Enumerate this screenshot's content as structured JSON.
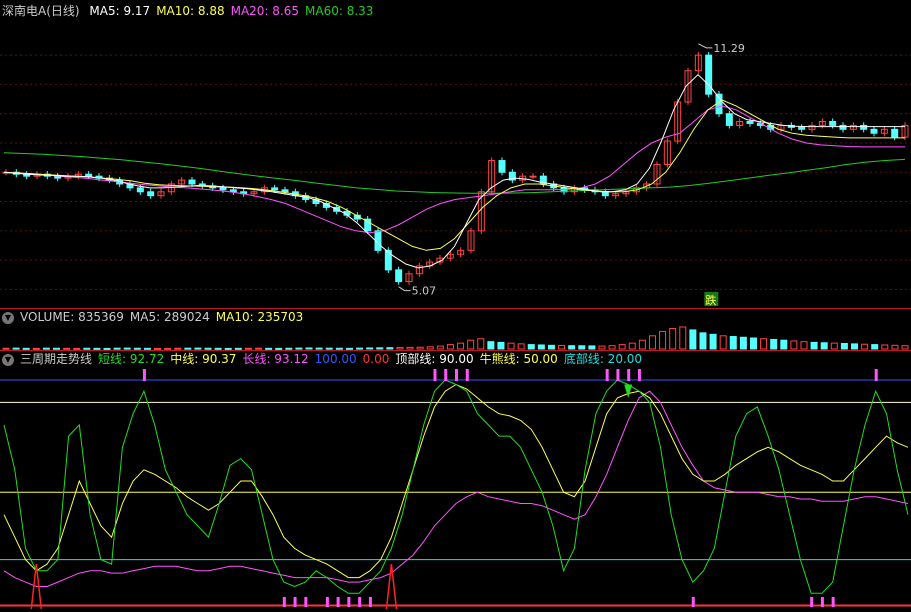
{
  "main": {
    "title": "深南电A(日线)",
    "ma_labels": [
      {
        "text": "MA5: 9.17",
        "color": "#ffffff"
      },
      {
        "text": "MA10: 8.88",
        "color": "#ffff54"
      },
      {
        "text": "MA20: 8.65",
        "color": "#ff54ff"
      },
      {
        "text": "MA60: 8.33",
        "color": "#22cc22"
      }
    ],
    "high_label": "11.29",
    "low_label": "5.07",
    "signal_label": "跌"
  },
  "volume": {
    "labels": [
      {
        "text": "VOLUME: 835369",
        "color": "#cccccc"
      },
      {
        "text": "MA5: 289024",
        "color": "#cccccc"
      },
      {
        "text": "MA10: 235703",
        "color": "#ffff54"
      }
    ]
  },
  "indicator": {
    "labels": [
      {
        "text": "三周期走势线",
        "color": "#cccccc"
      },
      {
        "text": "短线: 92.72",
        "color": "#22dd22"
      },
      {
        "text": "中线: 90.37",
        "color": "#ffff54"
      },
      {
        "text": "长线: 93.12",
        "color": "#ff54ff"
      },
      {
        "text": "100.00",
        "color": "#3355ff"
      },
      {
        "text": "0.00",
        "color": "#ff3333"
      },
      {
        "text": "顶部线: 90.00",
        "color": "#ffffff"
      },
      {
        "text": "牛熊线: 50.00",
        "color": "#ffff54"
      },
      {
        "text": "底部线: 20.00",
        "color": "#22dddd"
      }
    ]
  },
  "chart_data": {
    "type": "line",
    "price": {
      "close": [
        8.0,
        7.95,
        7.9,
        7.95,
        7.9,
        7.85,
        7.9,
        7.95,
        7.9,
        7.85,
        7.8,
        7.7,
        7.6,
        7.5,
        7.4,
        7.5,
        7.7,
        7.8,
        7.7,
        7.65,
        7.6,
        7.55,
        7.5,
        7.45,
        7.5,
        7.6,
        7.55,
        7.5,
        7.4,
        7.3,
        7.2,
        7.1,
        7.0,
        6.9,
        6.8,
        6.5,
        6.0,
        5.5,
        5.2,
        5.4,
        5.6,
        5.7,
        5.8,
        5.9,
        6.0,
        6.5,
        7.5,
        8.3,
        8.0,
        7.8,
        7.9,
        7.9,
        7.7,
        7.6,
        7.5,
        7.6,
        7.55,
        7.5,
        7.4,
        7.45,
        7.5,
        7.6,
        7.7,
        8.2,
        8.8,
        9.8,
        10.6,
        11.0,
        10.0,
        9.5,
        9.2,
        9.3,
        9.25,
        9.2,
        9.1,
        9.2,
        9.15,
        9.1,
        9.2,
        9.3,
        9.2,
        9.1,
        9.2,
        9.1,
        9.0,
        9.1,
        8.9,
        9.2
      ],
      "ma5": [
        8.0,
        7.97,
        7.95,
        7.93,
        7.92,
        7.9,
        7.9,
        7.88,
        7.85,
        7.8,
        7.72,
        7.65,
        7.6,
        7.6,
        7.62,
        7.64,
        7.66,
        7.65,
        7.63,
        7.6,
        7.58,
        7.54,
        7.5,
        7.45,
        7.4,
        7.35,
        7.25,
        7.1,
        6.95,
        6.7,
        6.4,
        6.1,
        5.85,
        5.65,
        5.55,
        5.6,
        5.75,
        6.1,
        6.7,
        7.3,
        7.6,
        7.8,
        7.85,
        7.82,
        7.75,
        7.7,
        7.65,
        7.6,
        7.55,
        7.5,
        7.5,
        7.55,
        7.7,
        8.1,
        8.8,
        9.6,
        10.2,
        10.5,
        10.2,
        9.8,
        9.5,
        9.35,
        9.3,
        9.25,
        9.2,
        9.18,
        9.17,
        9.17,
        9.17,
        9.17,
        9.17,
        9.17,
        9.17,
        9.17,
        9.17
      ],
      "ma10": [
        8.0,
        7.98,
        7.96,
        7.94,
        7.92,
        7.9,
        7.88,
        7.85,
        7.82,
        7.78,
        7.72,
        7.68,
        7.66,
        7.65,
        7.64,
        7.63,
        7.62,
        7.6,
        7.57,
        7.53,
        7.48,
        7.42,
        7.35,
        7.25,
        7.1,
        6.9,
        6.7,
        6.5,
        6.3,
        6.1,
        6.0,
        6.05,
        6.3,
        6.7,
        7.1,
        7.4,
        7.6,
        7.7,
        7.7,
        7.65,
        7.6,
        7.55,
        7.52,
        7.5,
        7.5,
        7.55,
        7.7,
        8.0,
        8.5,
        9.1,
        9.6,
        9.85,
        9.7,
        9.5,
        9.3,
        9.1,
        9.0,
        8.95,
        8.92,
        8.9,
        8.88,
        8.88,
        8.88,
        8.88,
        8.88
      ],
      "ma20": [
        8.0,
        7.98,
        7.96,
        7.93,
        7.9,
        7.87,
        7.84,
        7.8,
        7.76,
        7.72,
        7.68,
        7.65,
        7.62,
        7.6,
        7.57,
        7.54,
        7.5,
        7.45,
        7.38,
        7.3,
        7.2,
        7.05,
        6.9,
        6.75,
        6.6,
        6.5,
        6.45,
        6.5,
        6.65,
        6.85,
        7.05,
        7.2,
        7.3,
        7.35,
        7.4,
        7.45,
        7.5,
        7.55,
        7.55,
        7.55,
        7.56,
        7.6,
        7.7,
        7.9,
        8.2,
        8.5,
        8.75,
        8.9,
        9.0,
        9.3,
        9.6,
        9.7,
        9.6,
        9.4,
        9.2,
        9.0,
        8.85,
        8.75,
        8.7,
        8.68,
        8.66,
        8.65,
        8.65,
        8.65,
        8.65
      ],
      "ma60": [
        8.5,
        8.48,
        8.46,
        8.43,
        8.4,
        8.36,
        8.32,
        8.27,
        8.22,
        8.16,
        8.1,
        8.03,
        7.96,
        7.9,
        7.84,
        7.78,
        7.72,
        7.66,
        7.6,
        7.56,
        7.52,
        7.5,
        7.48,
        7.47,
        7.46,
        7.46,
        7.47,
        7.48,
        7.5,
        7.52,
        7.54,
        7.56,
        7.58,
        7.6,
        7.62,
        7.66,
        7.72,
        7.78,
        7.85,
        7.92,
        7.98,
        8.05,
        8.12,
        8.2,
        8.26,
        8.3,
        8.33
      ],
      "high": 11.29,
      "low": 5.07,
      "ylim": [
        4.6,
        11.9
      ]
    },
    "volume": {
      "values": [
        10,
        12,
        9,
        8,
        11,
        10,
        9,
        8,
        10,
        9,
        8,
        11,
        12,
        10,
        9,
        8,
        9,
        10,
        11,
        12,
        10,
        9,
        8,
        9,
        10,
        11,
        9,
        8,
        10,
        12,
        14,
        12,
        11,
        10,
        9,
        12,
        14,
        16,
        18,
        20,
        22,
        24,
        30,
        40,
        60,
        80,
        120,
        140,
        100,
        90,
        80,
        70,
        60,
        55,
        50,
        48,
        45,
        44,
        42,
        40,
        45,
        60,
        80,
        120,
        180,
        240,
        280,
        300,
        260,
        220,
        200,
        180,
        170,
        160,
        150,
        140,
        130,
        120,
        110,
        100,
        90,
        85,
        80,
        75,
        70,
        65,
        60,
        55,
        50,
        45
      ],
      "ma5": 289024,
      "ma10": 235703,
      "current": 835369
    },
    "indicator": {
      "short": [
        80,
        60,
        25,
        15,
        15,
        20,
        75,
        80,
        40,
        20,
        18,
        70,
        85,
        95,
        80,
        60,
        50,
        40,
        35,
        30,
        45,
        62,
        65,
        60,
        40,
        20,
        10,
        8,
        10,
        15,
        12,
        8,
        5,
        5,
        10,
        15,
        25,
        40,
        60,
        80,
        95,
        100,
        98,
        95,
        85,
        80,
        75,
        75,
        70,
        60,
        50,
        35,
        15,
        25,
        60,
        85,
        95,
        100,
        98,
        95,
        90,
        70,
        40,
        20,
        10,
        15,
        25,
        50,
        75,
        85,
        88,
        75,
        60,
        40,
        20,
        5,
        5,
        10,
        35,
        60,
        80,
        95,
        85,
        60,
        40
      ],
      "mid": [
        40,
        30,
        20,
        15,
        18,
        25,
        40,
        55,
        45,
        35,
        30,
        45,
        55,
        60,
        58,
        55,
        52,
        48,
        45,
        42,
        45,
        50,
        55,
        55,
        48,
        40,
        30,
        25,
        22,
        20,
        18,
        15,
        12,
        12,
        15,
        20,
        30,
        45,
        60,
        75,
        88,
        95,
        98,
        96,
        92,
        88,
        85,
        84,
        82,
        78,
        70,
        60,
        50,
        48,
        55,
        70,
        85,
        92,
        94,
        95,
        92,
        85,
        75,
        65,
        58,
        55,
        55,
        58,
        62,
        65,
        68,
        70,
        68,
        65,
        62,
        60,
        58,
        55,
        55,
        60,
        65,
        70,
        75,
        72,
        70
      ],
      "long": [
        15,
        12,
        10,
        8,
        8,
        10,
        12,
        14,
        15,
        15,
        14,
        14,
        15,
        16,
        17,
        17,
        17,
        16,
        15,
        15,
        16,
        17,
        17,
        16,
        15,
        14,
        13,
        12,
        12,
        12,
        12,
        11,
        10,
        10,
        11,
        12,
        14,
        18,
        22,
        28,
        35,
        40,
        45,
        48,
        50,
        48,
        47,
        46,
        45,
        45,
        44,
        42,
        40,
        38,
        40,
        48,
        58,
        70,
        82,
        92,
        95,
        90,
        80,
        70,
        62,
        55,
        52,
        51,
        50,
        50,
        50,
        49,
        48,
        48,
        47,
        47,
        46,
        46,
        46,
        47,
        48,
        48,
        47,
        46,
        45
      ],
      "lines": {
        "top": 90,
        "bull_bear": 50,
        "bottom": 20,
        "max": 100,
        "min": 0
      },
      "ylim": [
        -2,
        104
      ]
    }
  }
}
